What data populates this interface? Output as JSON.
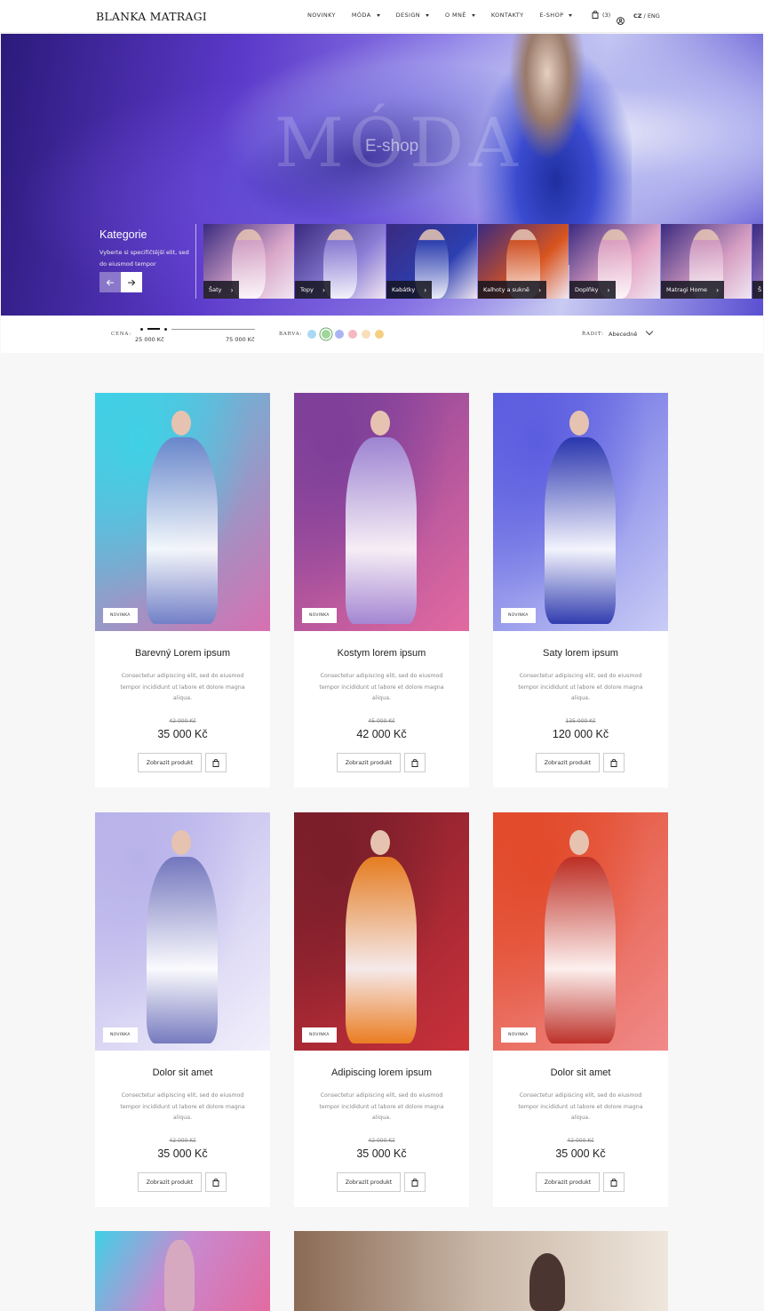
{
  "header": {
    "logo": "BLANKA MATRAGI",
    "nav": [
      {
        "label": "NOVINKY",
        "has_dropdown": false
      },
      {
        "label": "MÓDA",
        "has_dropdown": true
      },
      {
        "label": "DESIGN",
        "has_dropdown": true
      },
      {
        "label": "O MNĚ",
        "has_dropdown": true
      },
      {
        "label": "KONTAKTY",
        "has_dropdown": false
      },
      {
        "label": "E-SHOP",
        "has_dropdown": true
      }
    ],
    "cart_count": "(3)",
    "lang_active": "CZ",
    "lang_separator": " / ",
    "lang_other": "ENG"
  },
  "hero": {
    "heading": "MÓDA",
    "subheading": "E-shop",
    "category_title": "Kategorie",
    "category_text": "Vyberte si specifičtější elit, sed do eiusmod tempor",
    "categories": [
      {
        "label": "Šaty",
        "color": "#d9a6c8"
      },
      {
        "label": "Topy",
        "color": "#8d7fd6"
      },
      {
        "label": "Kabátky",
        "color": "#2c3fb0"
      },
      {
        "label": "Kalhoty a sukně",
        "color": "#d8541e"
      },
      {
        "label": "Doplňky",
        "color": "#e4a5c4"
      },
      {
        "label": "Matragi Home",
        "color": "#d69ec2"
      },
      {
        "label": "Š",
        "color": "#b08ad0"
      }
    ]
  },
  "filters": {
    "price_label": "CENA:",
    "price_min": "25 000 Kč",
    "price_max": "75 000 Kč",
    "color_label": "BARVA:",
    "colors": [
      "#a9d8f5",
      "#9fd69a",
      "#aab4f5",
      "#f5b8c2",
      "#f8dfb8",
      "#f5cf80"
    ],
    "sort_label": "ŘADIT:",
    "sort_value": "Abecedně"
  },
  "products": [
    {
      "title": "Barevný Lorem ipsum",
      "badge": "NOVINKA",
      "desc": "Consectetur adipiscing elit, sed do eiusmod tempor incididunt ut labore et dolore magna aliqua.",
      "old_price": "42 000 Kč",
      "price": "35 000 Kč",
      "detail_label": "Zobrazit produkt",
      "bg1": "#3fd1e6",
      "bg2": "#d86fb0",
      "dress": "#6b7fc8"
    },
    {
      "title": "Kostym lorem ipsum",
      "badge": "NOVINKA",
      "desc": "Consectetur adipiscing elit, sed do eiusmod tempor incididunt ut labore et dolore magna aliqua.",
      "old_price": "45 000 Kč",
      "price": "42 000 Kč",
      "detail_label": "Zobrazit produkt",
      "bg1": "#7d3f9a",
      "bg2": "#e36aa0",
      "dress": "#a08bd8"
    },
    {
      "title": "Saty lorem ipsum",
      "badge": "NOVINKA",
      "desc": "Consectetur adipiscing elit, sed do eiusmod tempor incididunt ut labore et dolore magna aliqua.",
      "old_price": "135 000 Kč",
      "price": "120 000 Kč",
      "detail_label": "Zobrazit produkt",
      "bg1": "#5b5de0",
      "bg2": "#c9ccf5",
      "dress": "#2330a8"
    },
    {
      "title": "Dolor sit amet",
      "badge": "NOVINKA",
      "desc": "Consectetur adipiscing elit, sed do eiusmod tempor incididunt ut labore et dolore magna aliqua.",
      "old_price": "42 000 Kč",
      "price": "35 000 Kč",
      "detail_label": "Zobrazit produkt",
      "bg1": "#b8b2ea",
      "bg2": "#f2f0fb",
      "dress": "#6a6fb8"
    },
    {
      "title": "Adipiscing lorem ipsum",
      "badge": "NOVINKA",
      "desc": "Consectetur adipiscing elit, sed do eiusmod tempor incididunt ut labore et dolore magna aliqua.",
      "old_price": "42 000 Kč",
      "price": "35 000 Kč",
      "detail_label": "Zobrazit produkt",
      "bg1": "#7a1e2a",
      "bg2": "#c9313b",
      "dress": "#f0861f"
    },
    {
      "title": "Dolor sit amet",
      "badge": "NOVINKA",
      "desc": "Consectetur adipiscing elit, sed do eiusmod tempor incididunt ut labore et dolore magna aliqua.",
      "old_price": "42 000 Kč",
      "price": "35 000 Kč",
      "detail_label": "Zobrazit produkt",
      "bg1": "#e24a2a",
      "bg2": "#f08a8a",
      "dress": "#b82a22"
    }
  ]
}
